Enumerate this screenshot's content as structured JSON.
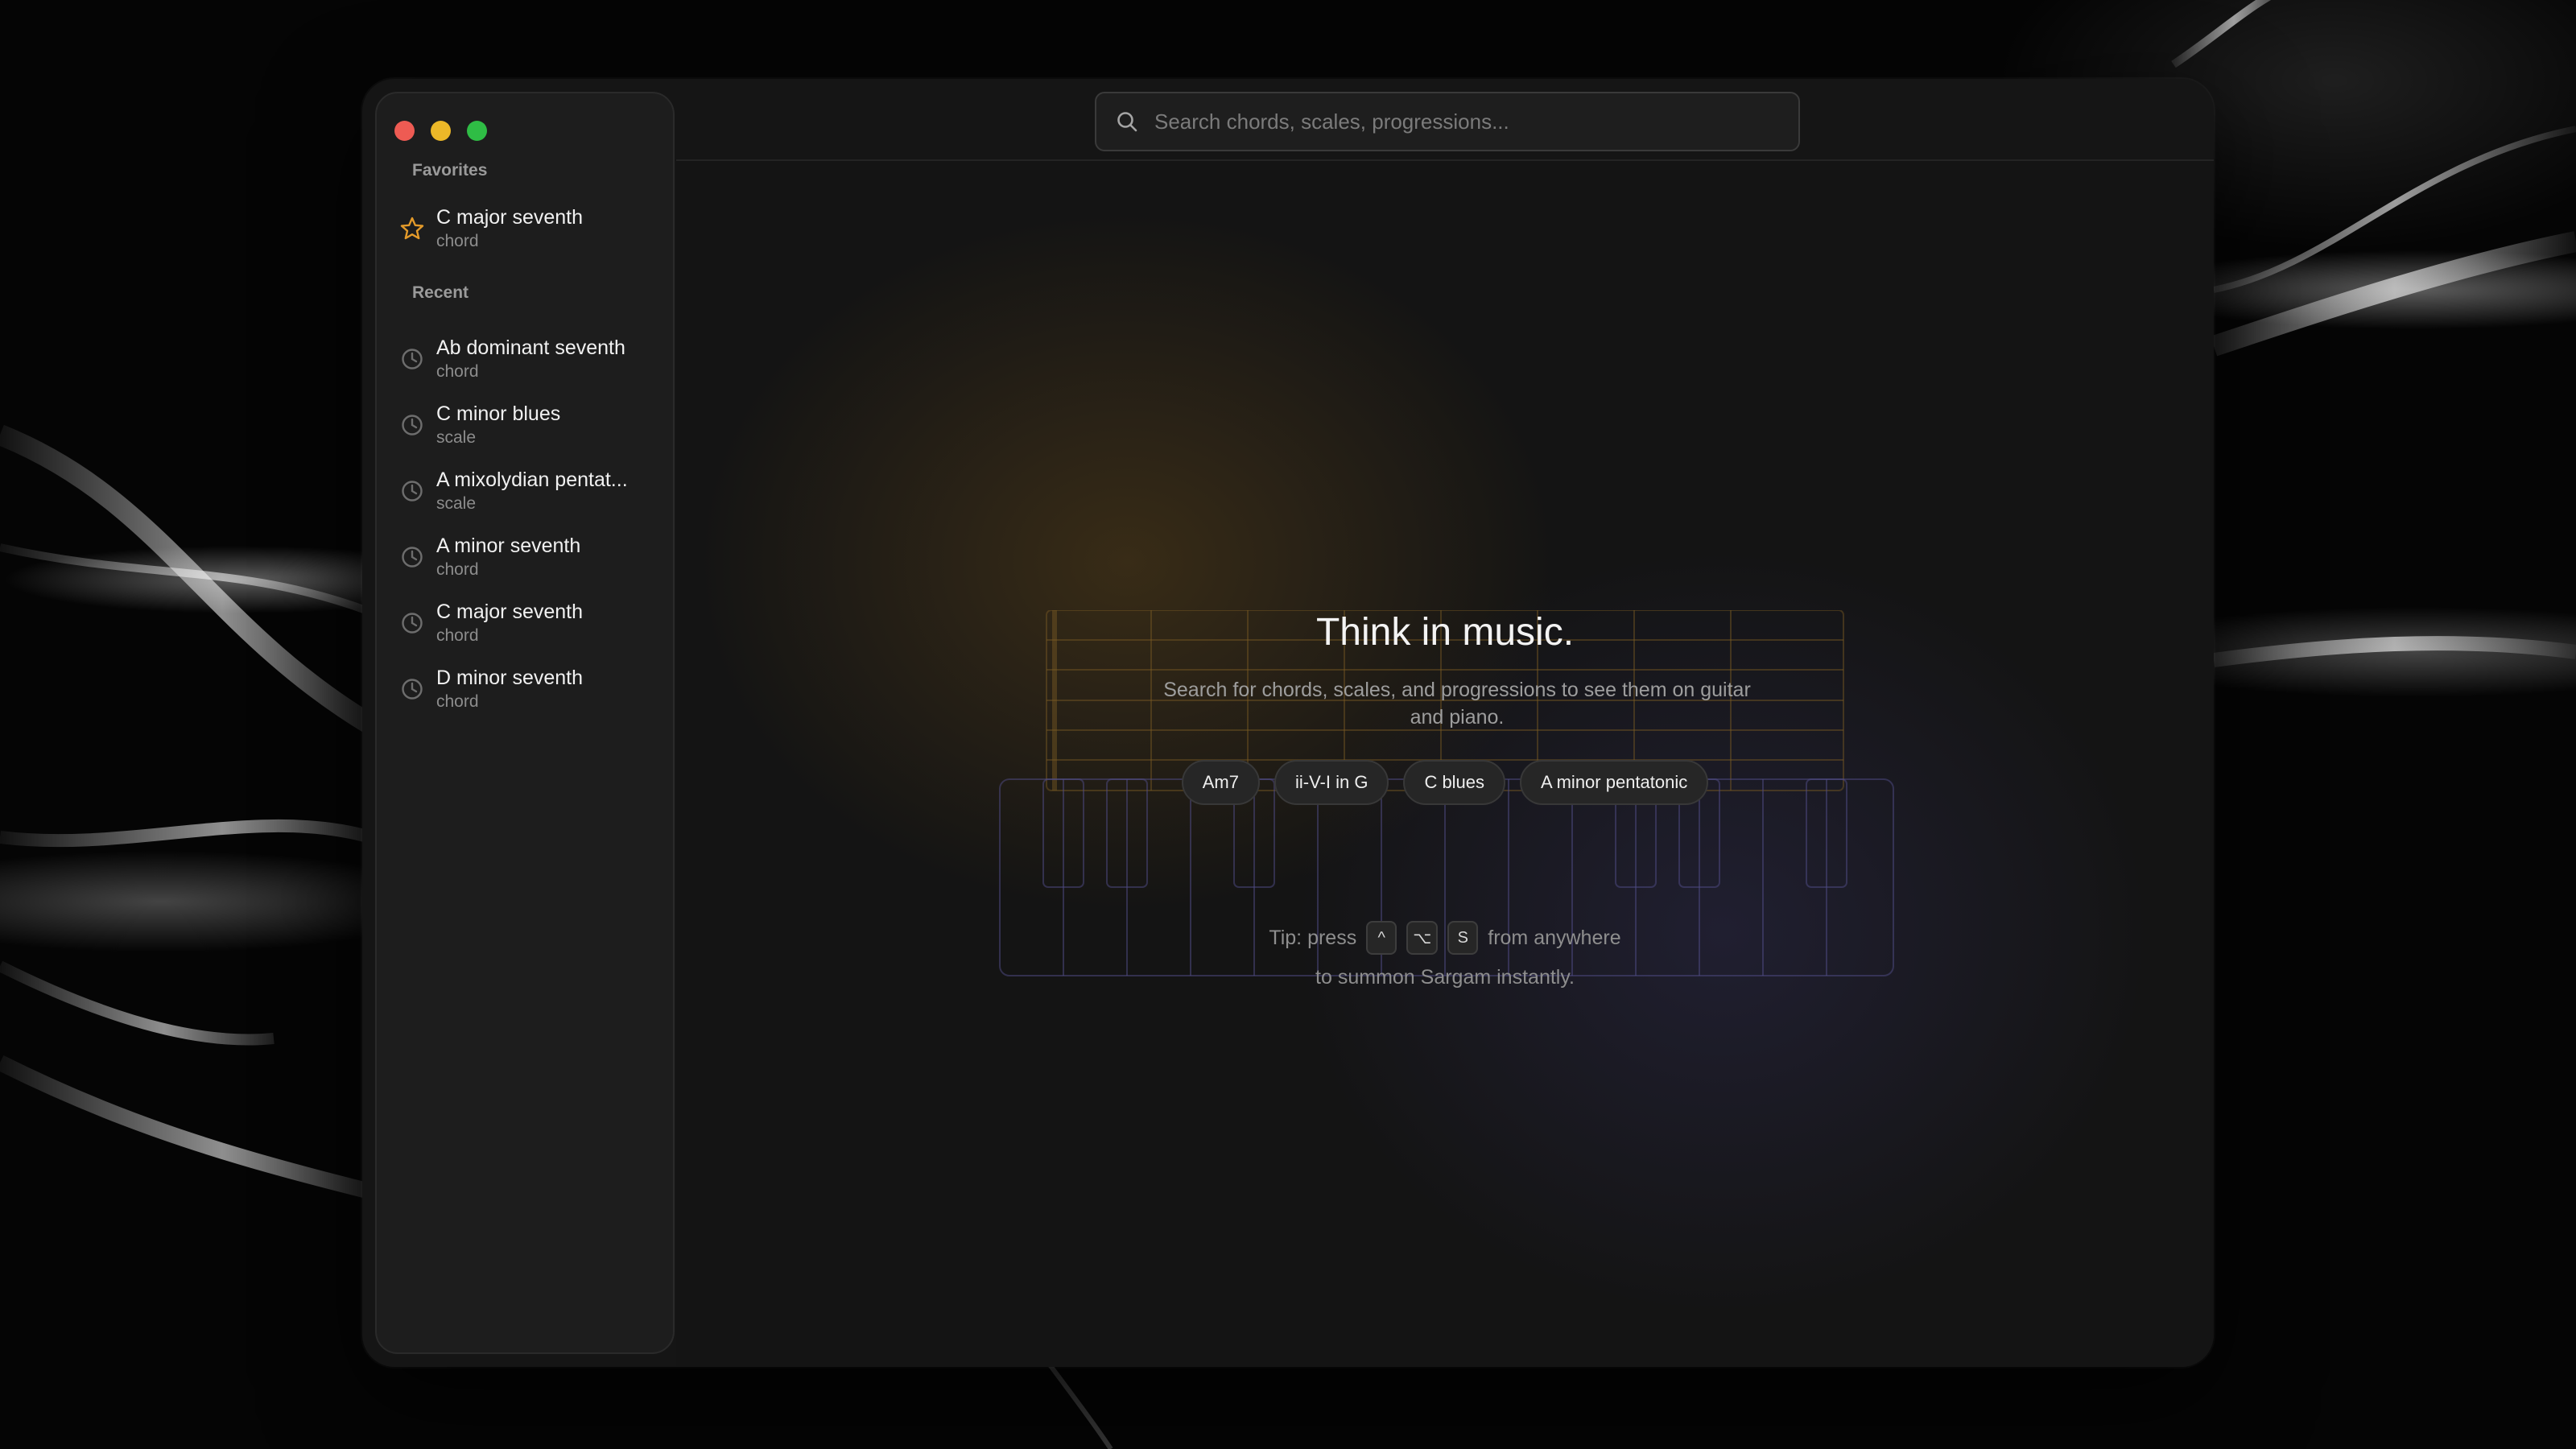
{
  "window": {
    "traffic_lights": {
      "close": "#ee5b53",
      "minimize": "#ecb828",
      "zoom": "#2fbd45"
    }
  },
  "search": {
    "placeholder": "Search chords, scales, progressions...",
    "icon": "search-icon"
  },
  "sidebar": {
    "favorites_label": "Favorites",
    "favorites": [
      {
        "name": "C major seventh",
        "type": "chord",
        "icon": "star-icon"
      }
    ],
    "recent_label": "Recent",
    "recent": [
      {
        "name": "Ab dominant seventh",
        "type": "chord",
        "icon": "clock-icon"
      },
      {
        "name": "C minor blues",
        "type": "scale",
        "icon": "clock-icon"
      },
      {
        "name": "A mixolydian pentat...",
        "type": "scale",
        "icon": "clock-icon"
      },
      {
        "name": "A minor seventh",
        "type": "chord",
        "icon": "clock-icon"
      },
      {
        "name": "C major seventh",
        "type": "chord",
        "icon": "clock-icon"
      },
      {
        "name": "D minor seventh",
        "type": "chord",
        "icon": "clock-icon"
      }
    ]
  },
  "hero": {
    "title": "Think in music.",
    "subtitle": "Search for chords, scales, and progressions to see them on guitar and piano.",
    "chips": [
      "Am7",
      "ii-V-I in G",
      "C blues",
      "A minor pentatonic"
    ],
    "tip_prefix": "Tip: press",
    "tip_keys": [
      "^",
      "⌥",
      "S"
    ],
    "tip_suffix": "from anywhere",
    "tip_line2": "to summon Sargam instantly."
  },
  "colors": {
    "accent_star": "#e39a2a",
    "window_bg": "#151515",
    "sidebar_bg": "#1d1d1d"
  }
}
